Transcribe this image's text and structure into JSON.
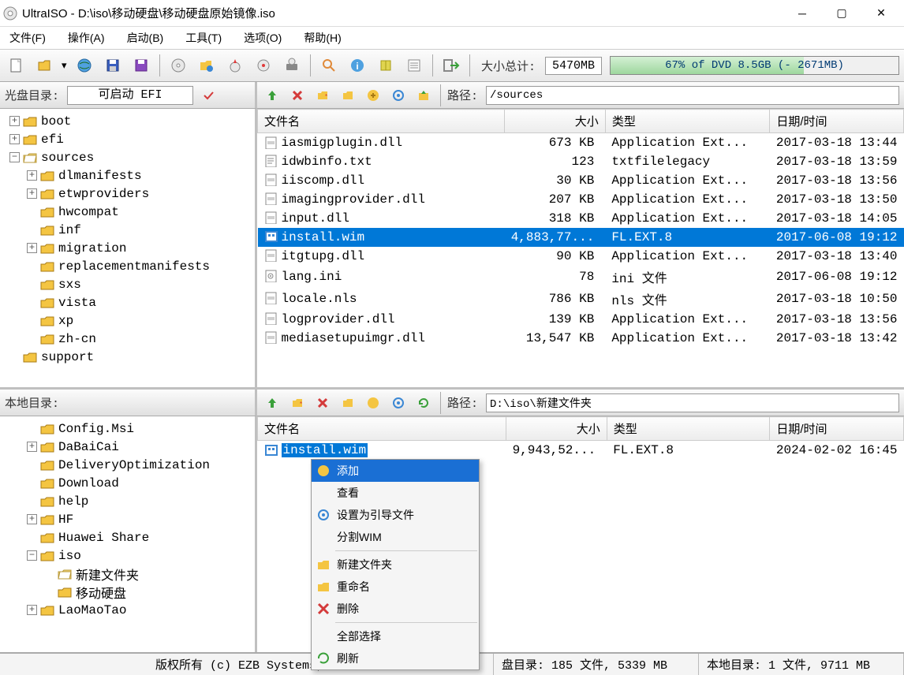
{
  "window": {
    "title": "UltraISO - D:\\iso\\移动硬盘\\移动硬盘原始镜像.iso"
  },
  "menu": {
    "file": "文件(F)",
    "action": "操作(A)",
    "boot": "启动(B)",
    "tool": "工具(T)",
    "option": "选项(O)",
    "help": "帮助(H)"
  },
  "totals": {
    "label": "大小总计:",
    "value": "5470MB",
    "progress_pct": 67,
    "progress_text": "67% of DVD 8.5GB (- 2671MB)"
  },
  "upper": {
    "tree_label": "光盘目录:",
    "boot_status": "可启动 EFI",
    "path_label": "路径:",
    "path_value": "/sources",
    "tree": [
      {
        "lvl": 0,
        "pm": "+",
        "name": "boot",
        "open": false
      },
      {
        "lvl": 0,
        "pm": "+",
        "name": "efi",
        "open": false
      },
      {
        "lvl": 0,
        "pm": "-",
        "name": "sources",
        "open": true
      },
      {
        "lvl": 1,
        "pm": "+",
        "name": "dlmanifests",
        "open": false
      },
      {
        "lvl": 1,
        "pm": "+",
        "name": "etwproviders",
        "open": false
      },
      {
        "lvl": 1,
        "pm": " ",
        "name": "hwcompat",
        "open": false
      },
      {
        "lvl": 1,
        "pm": " ",
        "name": "inf",
        "open": false
      },
      {
        "lvl": 1,
        "pm": "+",
        "name": "migration",
        "open": false
      },
      {
        "lvl": 1,
        "pm": " ",
        "name": "replacementmanifests",
        "open": false
      },
      {
        "lvl": 1,
        "pm": " ",
        "name": "sxs",
        "open": false
      },
      {
        "lvl": 1,
        "pm": " ",
        "name": "vista",
        "open": false
      },
      {
        "lvl": 1,
        "pm": " ",
        "name": "xp",
        "open": false
      },
      {
        "lvl": 1,
        "pm": " ",
        "name": "zh-cn",
        "open": false
      },
      {
        "lvl": 0,
        "pm": " ",
        "name": "support",
        "open": false
      }
    ],
    "cols": {
      "name": "文件名",
      "size": "大小",
      "type": "类型",
      "date": "日期/时间"
    },
    "files": [
      {
        "icon": "dll",
        "name": "iasmigplugin.dll",
        "size": "673 KB",
        "type": "Application Ext...",
        "date": "2017-03-18 13:44"
      },
      {
        "icon": "txt",
        "name": "idwbinfo.txt",
        "size": "123",
        "type": "txtfilelegacy",
        "date": "2017-03-18 13:59"
      },
      {
        "icon": "dll",
        "name": "iiscomp.dll",
        "size": "30 KB",
        "type": "Application Ext...",
        "date": "2017-03-18 13:56"
      },
      {
        "icon": "dll",
        "name": "imagingprovider.dll",
        "size": "207 KB",
        "type": "Application Ext...",
        "date": "2017-03-18 13:50"
      },
      {
        "icon": "dll",
        "name": "input.dll",
        "size": "318 KB",
        "type": "Application Ext...",
        "date": "2017-03-18 14:05"
      },
      {
        "icon": "wim",
        "name": "install.wim",
        "size": "4,883,77...",
        "type": "FL.EXT.8",
        "date": "2017-06-08 19:12",
        "sel": true
      },
      {
        "icon": "dll",
        "name": "itgtupg.dll",
        "size": "90 KB",
        "type": "Application Ext...",
        "date": "2017-03-18 13:40"
      },
      {
        "icon": "ini",
        "name": "lang.ini",
        "size": "78",
        "type": "ini 文件",
        "date": "2017-06-08 19:12"
      },
      {
        "icon": "nls",
        "name": "locale.nls",
        "size": "786 KB",
        "type": "nls 文件",
        "date": "2017-03-18 10:50"
      },
      {
        "icon": "dll",
        "name": "logprovider.dll",
        "size": "139 KB",
        "type": "Application Ext...",
        "date": "2017-03-18 13:56"
      },
      {
        "icon": "dll",
        "name": "mediasetupuimgr.dll",
        "size": "13,547 KB",
        "type": "Application Ext...",
        "date": "2017-03-18 13:42"
      }
    ]
  },
  "lower": {
    "tree_label": "本地目录:",
    "path_label": "路径:",
    "path_value": "D:\\iso\\新建文件夹",
    "tree": [
      {
        "lvl": 1,
        "pm": " ",
        "name": "Config.Msi"
      },
      {
        "lvl": 1,
        "pm": "+",
        "name": "DaBaiCai"
      },
      {
        "lvl": 1,
        "pm": " ",
        "name": "DeliveryOptimization"
      },
      {
        "lvl": 1,
        "pm": " ",
        "name": "Download"
      },
      {
        "lvl": 1,
        "pm": " ",
        "name": "help"
      },
      {
        "lvl": 1,
        "pm": "+",
        "name": "HF"
      },
      {
        "lvl": 1,
        "pm": " ",
        "name": "Huawei Share"
      },
      {
        "lvl": 1,
        "pm": "-",
        "name": "iso"
      },
      {
        "lvl": 2,
        "pm": " ",
        "name": "新建文件夹",
        "open": true
      },
      {
        "lvl": 2,
        "pm": " ",
        "name": "移动硬盘"
      },
      {
        "lvl": 1,
        "pm": "+",
        "name": "LaoMaoTao"
      }
    ],
    "cols": {
      "name": "文件名",
      "size": "大小",
      "type": "类型",
      "date": "日期/时间"
    },
    "files": [
      {
        "icon": "wim",
        "name": "install.wim",
        "size": "9,943,52...",
        "type": "FL.EXT.8",
        "date": "2024-02-02 16:45",
        "sel": true
      }
    ]
  },
  "context": {
    "items": [
      "添加",
      "查看",
      "设置为引导文件",
      "分割WIM",
      "-",
      "新建文件夹",
      "重命名",
      "删除",
      "-",
      "全部选择",
      "刷新"
    ],
    "selected_index": 0
  },
  "status": {
    "copyright": "版权所有 (c) EZB Systems, I",
    "disc": "盘目录: 185 文件, 5339 MB",
    "local": "本地目录: 1 文件, 9711 MB"
  }
}
